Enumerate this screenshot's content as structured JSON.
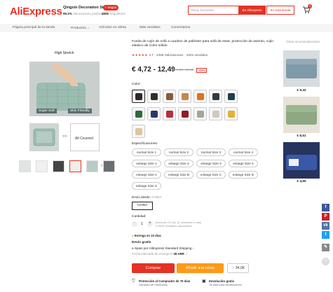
{
  "header": {
    "logo": "AliExpress",
    "store_name": "Qingxin Decoration Store",
    "follow_label": "+ Seguir",
    "positive_pct": "96.2%",
    "positive_label": "Valoraciones positivas",
    "followers": "1656",
    "followers_label": "Seguidores",
    "search_placeholder": "Estoy buscando...",
    "search_aliexpress_label": "En AliExpress",
    "search_store_label": "En esta tienda",
    "cart_count": "0"
  },
  "nav": {
    "items": [
      "Página principal de la tienda",
      "Productos",
      "Artículos en oferta",
      "Más vendidos",
      "Comentarios"
    ]
  },
  "gallery": {
    "heading": "High Stretch",
    "labels": [
      "Super Soft",
      "Skin Friendly"
    ],
    "covered_label": "All Covered"
  },
  "product": {
    "title": "Funda de cojín de sofá a cuadros de poliéster para sofá de estar, protección de asiento, cojín elástico de Color sólido",
    "stars": "★★★★★",
    "rating": "4.7",
    "reviews": "2458 Valoraciones",
    "sold": "4302 vendidos",
    "price": "€ 4,72 - 12,49",
    "orig_price": "€ 9,35 - 24,60",
    "discount": "-49%",
    "color_label": "Color:",
    "spec_label": "Especificaciones:",
    "sizes": [
      "normal Size 1",
      "normal Size 2",
      "normal Size 3",
      "normal Size 4",
      "enlarge Size 1",
      "enlarge Size 2",
      "enlarge Size 3",
      "enlarge Size 4",
      "enlarge Size A",
      "enlarge Size B",
      "enlarge Size C",
      "enlarge Size D",
      "enlarge Size S"
    ],
    "ship_from_label": "Envío desde:",
    "ship_from_value": "CHINA",
    "ship_option": "CHINA",
    "qty_label": "Cantidad:",
    "qty_value": "1",
    "qty_info1": "Adicional 1% dto. (5 unidades o más)",
    "qty_info2": "175909 Unidades disponibles",
    "delivery_head": "Entrega en 10 días",
    "ship_head": "Envío gratis",
    "ship_to": "a Spain por AliExpress Standard Shipping",
    "ship_est_label": "Fecha estimada de entrega el",
    "ship_est_date": "28 ABR",
    "buy_label": "Comprar",
    "cart_label": "Añadir a la cesta",
    "wish_count": "34.0K",
    "guarantee1_title": "Protección al Comprador de 75 días",
    "guarantee1_sub": "Garantía de reembolso",
    "guarantee2_title": "Devolución gratis",
    "guarantee2_sub": "15 días para devoluciones"
  },
  "recommend": {
    "heading": "Otras recomendaciones",
    "prices": [
      "€ 9,42",
      "€ 8,51",
      "€ 4,65"
    ]
  },
  "colors": {
    "accent": "#e43225",
    "orange": "#ff9a16",
    "swatches": [
      "#2a2a2a",
      "#2f2f2f",
      "#8a5a3c",
      "#c4884c",
      "#e0721e",
      "#2f3a44",
      "#1f3f49",
      "#2f6a3a",
      "#24386a",
      "#b3313a",
      "#8e1d26",
      "#a8a49b",
      "#cfcac0",
      "#e0b237",
      "#dcc79d"
    ]
  }
}
